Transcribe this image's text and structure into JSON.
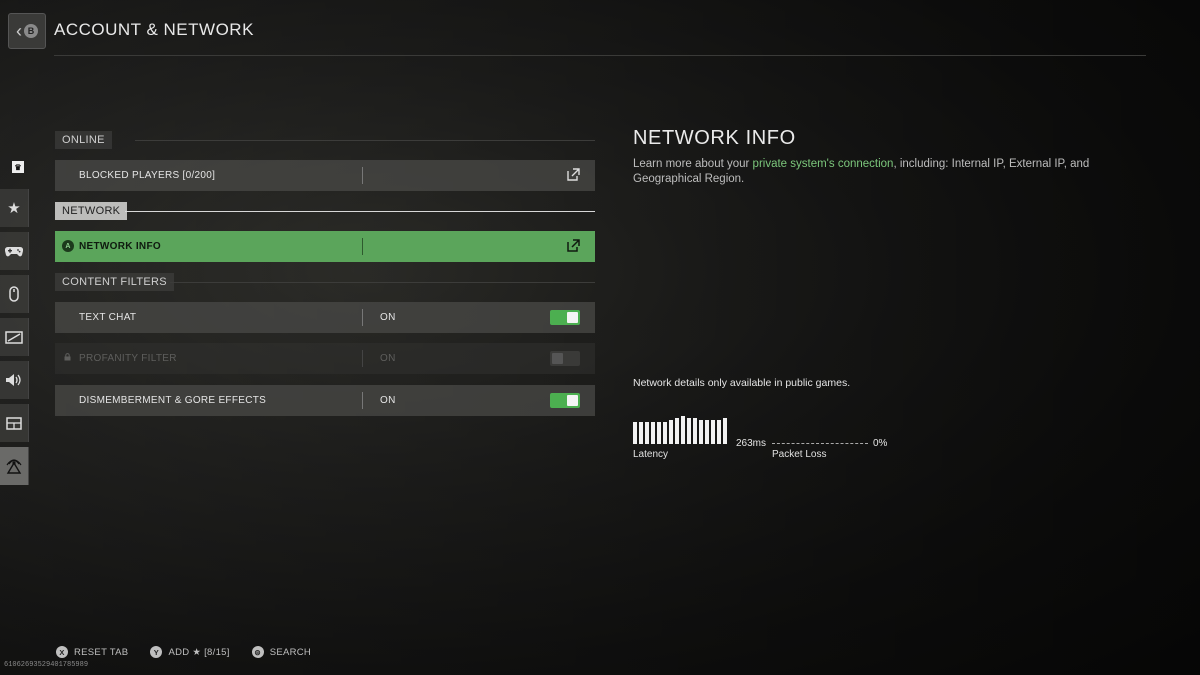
{
  "header": {
    "title": "ACCOUNT & NETWORK",
    "back_button_glyph": "B"
  },
  "sidenav": {
    "top_badge": "♛",
    "items": [
      {
        "icon": "star-icon",
        "glyph": "★"
      },
      {
        "icon": "gamepad-icon",
        "glyph": "🎮"
      },
      {
        "icon": "mouse-icon",
        "glyph": "🖱"
      },
      {
        "icon": "graphics-icon",
        "glyph": "▭"
      },
      {
        "icon": "audio-icon",
        "glyph": "🔊"
      },
      {
        "icon": "interface-icon",
        "glyph": "▤"
      },
      {
        "icon": "network-icon",
        "glyph": "⌾"
      }
    ]
  },
  "sections": {
    "online": {
      "label": "ONLINE",
      "rows": [
        {
          "name": "BLOCKED PLAYERS [0/200]"
        }
      ]
    },
    "network": {
      "label": "NETWORK",
      "rows": [
        {
          "name": "NETWORK INFO",
          "button_glyph": "A"
        }
      ]
    },
    "content_filters": {
      "label": "CONTENT FILTERS",
      "rows": [
        {
          "name": "TEXT CHAT",
          "value": "ON",
          "enabled": true
        },
        {
          "name": "PROFANITY FILTER",
          "value": "ON",
          "enabled": false
        },
        {
          "name": "DISMEMBERMENT & GORE EFFECTS",
          "value": "ON",
          "enabled": true
        }
      ]
    }
  },
  "info_panel": {
    "title": "NETWORK INFO",
    "desc_pre": "Learn more about your ",
    "desc_highlight": "private system's connection",
    "desc_post": ", including: Internal IP, External IP, and Geographical Region.",
    "note": "Network details only available in public games.",
    "latency_value": "263ms",
    "latency_label": "Latency",
    "packet_loss_value": "0%",
    "packet_loss_label": "Packet Loss"
  },
  "footer": {
    "hints": [
      {
        "button": "X",
        "label": "RESET TAB"
      },
      {
        "button": "Y",
        "label": "ADD ★ [8/15]"
      },
      {
        "button": "⊜",
        "label": "SEARCH"
      }
    ],
    "build_id": "6106269352940178598​9"
  },
  "colors": {
    "accent_green": "#5ba55b",
    "toggle_on": "#4caf50",
    "highlight_text": "#7cc77c"
  }
}
